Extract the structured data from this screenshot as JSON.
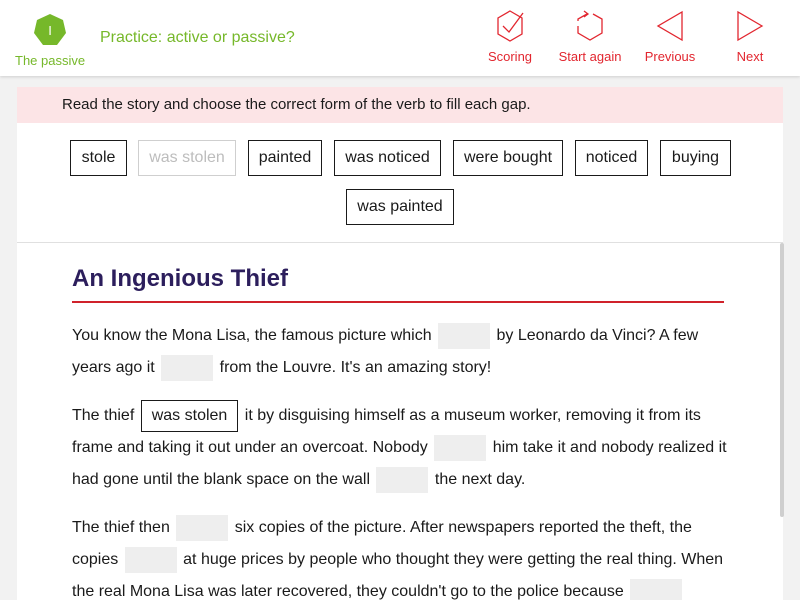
{
  "header": {
    "unit_badge": "I",
    "unit_label": "The passive",
    "activity_title": "Practice: active or passive?",
    "nav": {
      "scoring": "Scoring",
      "start_again": "Start again",
      "previous": "Previous",
      "next": "Next"
    }
  },
  "instruction": "Read the story and choose the correct form of the verb to fill each gap.",
  "word_bank": [
    {
      "label": "stole",
      "used": false
    },
    {
      "label": "was stolen",
      "used": true
    },
    {
      "label": "painted",
      "used": false
    },
    {
      "label": "was noticed",
      "used": false
    },
    {
      "label": "were bought",
      "used": false
    },
    {
      "label": "noticed",
      "used": false
    },
    {
      "label": "buying",
      "used": false
    },
    {
      "label": "was painted",
      "used": false
    }
  ],
  "story": {
    "title": "An Ingenious Thief",
    "p1": {
      "l1a": "You know the Mona Lisa, the famous picture which",
      "l1b": "by Leonardo da Vinci? A few",
      "l2a": "years ago it",
      "l2b": "from the Louvre. It's an amazing story!"
    },
    "p2": {
      "l1a": "The thief",
      "filled": "was stolen",
      "l1b": "it by disguising himself as a museum worker, removing it from its",
      "l2a": "frame and taking it out under an overcoat. Nobody",
      "l2b": "him take it and nobody realized it",
      "l3a": "had gone until the blank space on the wall",
      "l3b": "the next day."
    },
    "p3": {
      "l1a": "The thief then",
      "l1b": "six copies of the picture. After newspapers reported the theft, the",
      "l2a": "copies",
      "l2b": "at huge prices by people who thought they were getting the real thing. When",
      "l3a": "the real Mona Lisa was later recovered, they couldn't go to the police because"
    }
  },
  "colors": {
    "accent_green": "#76b82a",
    "accent_red": "#e2262f",
    "title_purple": "#2c1e5c",
    "instruction_bg": "#fce4e6"
  }
}
